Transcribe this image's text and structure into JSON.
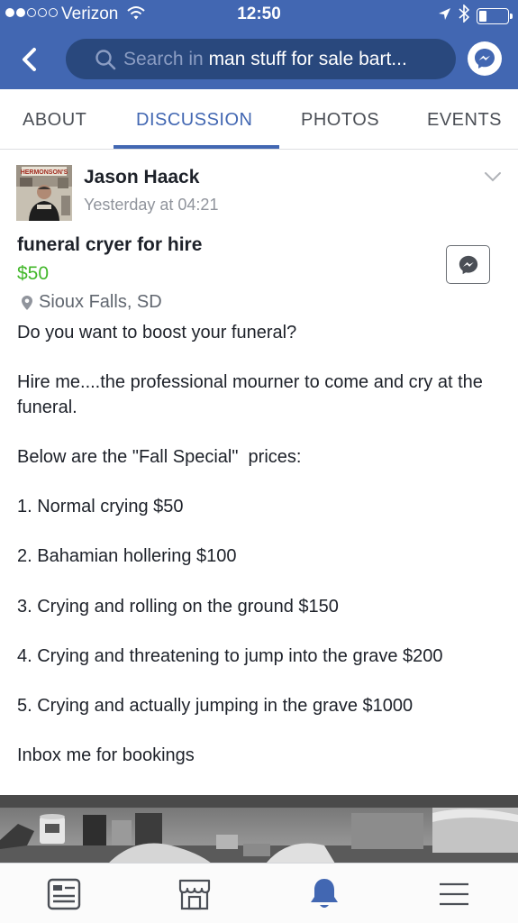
{
  "status_bar": {
    "carrier": "Verizon",
    "time": "12:50",
    "signal_bars_filled": 2,
    "signal_bars_total": 5,
    "battery_level": 0.25
  },
  "header": {
    "search_prefix": "Search in",
    "search_query": "man stuff for sale bart...",
    "accent_color": "#4267b2"
  },
  "tabs": [
    {
      "label": "ABOUT",
      "active": false
    },
    {
      "label": "DISCUSSION",
      "active": true
    },
    {
      "label": "PHOTOS",
      "active": false
    },
    {
      "label": "EVENTS",
      "active": false
    }
  ],
  "post": {
    "author": "Jason Haack",
    "timestamp": "Yesterday at 04:21",
    "avatar_sign": "HERMONSON'S",
    "title": "funeral cryer for hire",
    "price": "$50",
    "price_color": "#42b72a",
    "location": "Sioux Falls, SD",
    "body": {
      "line1": "Do you want to boost your funeral?",
      "line2": "Hire me....the professional mourner to come and cry at the funeral.",
      "line3": "Below are the \"Fall Special\"  prices:",
      "item1": "1. Normal crying $50",
      "item2": "2. Bahamian hollering $100",
      "item3": "3. Crying and rolling on the ground $150",
      "item4": "4. Crying and threatening to jump into the grave $200",
      "item5": "5. Crying and actually jumping in the grave $1000",
      "closing": "Inbox me for bookings"
    }
  },
  "bottom_nav": {
    "items": [
      {
        "icon": "news-feed-icon",
        "active": false
      },
      {
        "icon": "marketplace-icon",
        "active": false
      },
      {
        "icon": "bell-icon",
        "active": true
      },
      {
        "icon": "menu-icon",
        "active": false
      }
    ]
  }
}
